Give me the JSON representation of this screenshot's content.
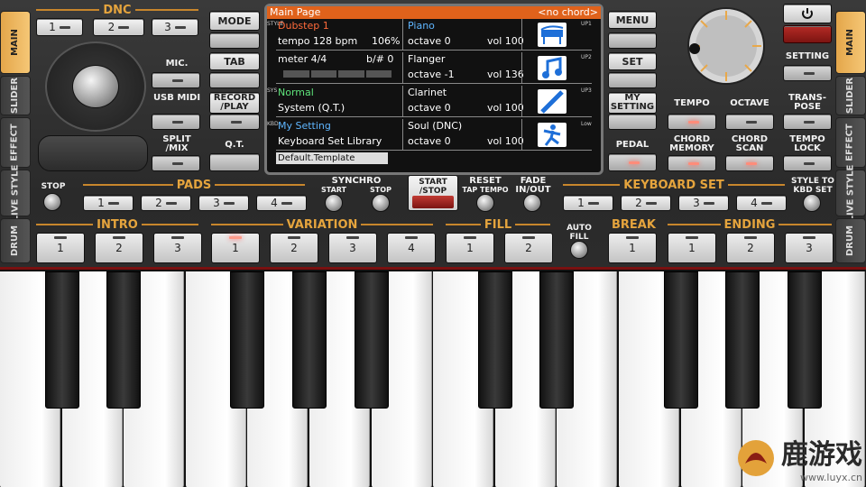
{
  "side_left": [
    "MAIN",
    "SLIDER",
    "EFFECT",
    "LIVE STYLE",
    "DRUM"
  ],
  "side_right": [
    "MAIN",
    "SLIDER",
    "EFFECT",
    "LIVE STYLE",
    "DRUM"
  ],
  "dnc": {
    "title": "DNC",
    "buttons": [
      "1",
      "2",
      "3"
    ]
  },
  "left_labels": {
    "mic": "MIC.",
    "usb_midi": "USB MIDI",
    "split_mix": "SPLIT /MIX"
  },
  "mid_buttons": {
    "mode": "MODE",
    "tab": "TAB",
    "record_play": "RECORD /PLAY",
    "qt": "Q.T."
  },
  "screen": {
    "title": "Main Page",
    "chord": "<no chord>",
    "rows": [
      {
        "a1": "Dubstep 1",
        "a2": "tempo 128 bpm",
        "a3": "106%",
        "b1": "Piano",
        "b2": "octave  0",
        "b3": "vol 100",
        "side": "UP1",
        "icon": "piano-icon",
        "left_tag": "STYLE"
      },
      {
        "a1": "meter 4/4",
        "a1r": "b/#  0",
        "b1": "Flanger",
        "b2": "octave -1",
        "b3": "vol 136",
        "side": "UP2",
        "icon": "music-note-icon"
      },
      {
        "a1": "Normal",
        "a2": "System (Q.T.)",
        "b1": "Clarinet",
        "b2": "octave  0",
        "b3": "vol 100",
        "side": "UP3",
        "icon": "clarinet-icon",
        "left_tag": "SYS"
      },
      {
        "a1": "My Setting",
        "a2": "Keyboard Set Library",
        "b1": "Soul (DNC)",
        "b2": "octave  0",
        "b3": "vol 100",
        "side": "Low",
        "icon": "dancer-icon",
        "left_tag": "KBD"
      }
    ],
    "footer": "Default.Template"
  },
  "right_buttons": {
    "menu": "MENU",
    "set": "SET",
    "my_setting": "MY SETTING",
    "pedal": "PEDAL",
    "setting": "SETTING"
  },
  "right_labels": {
    "tempo": "TEMPO",
    "octave": "OCTAVE",
    "transpose": "TRANS- POSE",
    "chord_memory": "CHORD MEMORY",
    "chord_scan": "CHORD SCAN",
    "tempo_lock": "TEMPO LOCK"
  },
  "pads": {
    "title": "PADS",
    "stop": "STOP",
    "buttons": [
      "1",
      "2",
      "3",
      "4"
    ]
  },
  "synchro": {
    "title": "SYNCHRO",
    "start": "START",
    "stop": "STOP"
  },
  "start_stop": "START /STOP",
  "reset": {
    "title": "RESET",
    "sub": "TAP TEMPO"
  },
  "fade": "FADE IN/OUT",
  "keyboard_set": {
    "title": "KEYBOARD SET",
    "buttons": [
      "1",
      "2",
      "3",
      "4"
    ],
    "style_to": "STYLE TO KBD SET"
  },
  "intro": {
    "title": "INTRO",
    "buttons": [
      "1",
      "2",
      "3"
    ]
  },
  "variation": {
    "title": "VARIATION",
    "buttons": [
      "1",
      "2",
      "3",
      "4"
    ]
  },
  "fill": {
    "title": "FILL",
    "buttons": [
      "1",
      "2"
    ]
  },
  "auto_fill": "AUTO FILL",
  "break": {
    "title": "BREAK",
    "buttons": [
      "1"
    ]
  },
  "ending": {
    "title": "ENDING",
    "buttons": [
      "1",
      "2",
      "3"
    ]
  },
  "watermark": {
    "t1": "鹿游戏",
    "t2": "www.luyx.cn"
  },
  "colors": {
    "accent": "#e5a43d",
    "screen_title": "#e0621b",
    "led_on": "#ff8c7a"
  }
}
